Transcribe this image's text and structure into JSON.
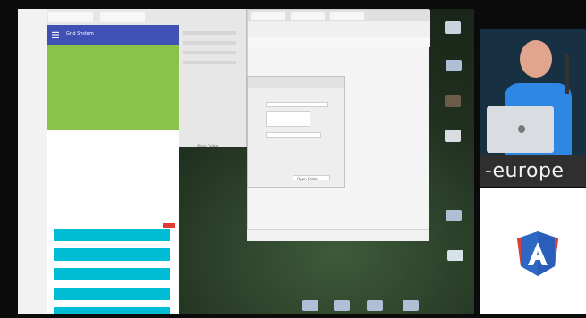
{
  "app": {
    "title": "Grid System"
  },
  "middle_window": {
    "footer_label": "Open Folder"
  },
  "dialog": {
    "footer_label": "Open Folder"
  },
  "presenter": {
    "brand_text": "-europe"
  },
  "colors": {
    "app_bar": "#3f51b5",
    "green": "#8bc34a",
    "cyan": "#00bcd4",
    "brand_bg": "#2f2f2f",
    "shield_blue": "#2f67c5",
    "shield_red": "#d94233"
  }
}
